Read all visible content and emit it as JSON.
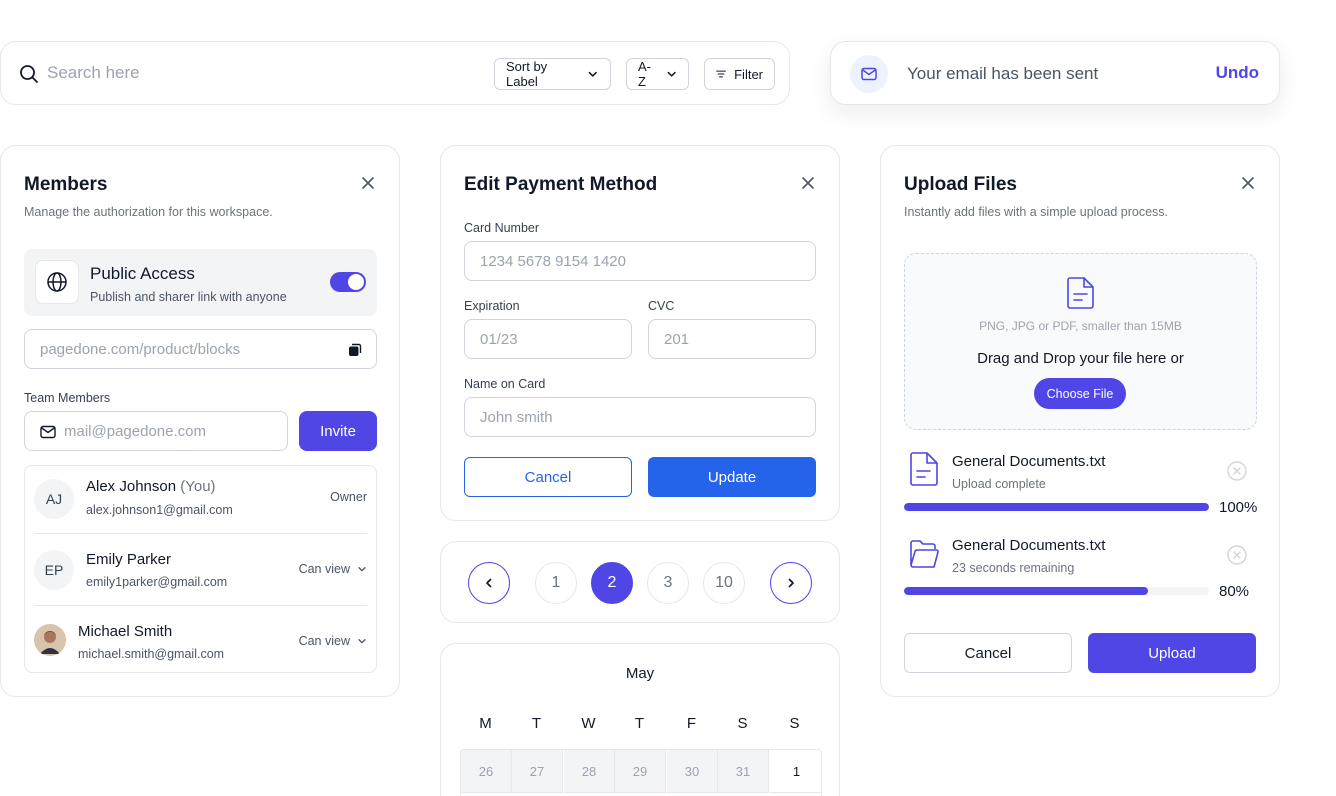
{
  "search": {
    "placeholder": "Search here",
    "sort_label": "Sort by Label",
    "order_label": "A-Z",
    "filter_label": "Filter"
  },
  "toast": {
    "message": "Your email has been sent",
    "action": "Undo"
  },
  "members": {
    "title": "Members",
    "subtitle": "Manage the authorization for this workspace.",
    "public_access": {
      "title": "Public Access",
      "subtitle": "Publish and sharer link with anyone",
      "enabled": true
    },
    "share_link": "pagedone.com/product/blocks",
    "team_label": "Team Members",
    "invite_placeholder": "mail@pagedone.com",
    "invite_button": "Invite",
    "list": [
      {
        "initials": "AJ",
        "name": "Alex Johnson",
        "you": "(You)",
        "email": "alex.johnson1@gmail.com",
        "role": "Owner"
      },
      {
        "initials": "EP",
        "name": "Emily Parker",
        "you": "",
        "email": "emily1parker@gmail.com",
        "role": "Can view"
      },
      {
        "initials": "",
        "name": "Michael Smith",
        "you": "",
        "email": "michael.smith@gmail.com",
        "role": "Can view"
      }
    ]
  },
  "payment": {
    "title": "Edit Payment Method",
    "card_label": "Card Number",
    "card_value": "1234 5678 9154 1420",
    "exp_label": "Expiration",
    "exp_value": "01/23",
    "cvc_label": "CVC",
    "cvc_value": "201",
    "name_label": "Name on Card",
    "name_value": "John smith",
    "cancel": "Cancel",
    "update": "Update"
  },
  "pagination": {
    "pages": [
      "1",
      "2",
      "3",
      "10"
    ],
    "current": "2"
  },
  "calendar": {
    "month": "May",
    "weekdays": [
      "M",
      "T",
      "W",
      "T",
      "F",
      "S",
      "S"
    ],
    "first_row": [
      "26",
      "27",
      "28",
      "29",
      "30",
      "31",
      "1"
    ]
  },
  "upload": {
    "title": "Upload Files",
    "subtitle": "Instantly add files with a simple upload process.",
    "hint": "PNG, JPG or PDF, smaller than 15MB",
    "drop_text": "Drag and Drop your file here or",
    "choose_button": "Choose File",
    "files": [
      {
        "name": "General Documents.txt",
        "status": "Upload complete",
        "progress_percent": 100,
        "label": "100%"
      },
      {
        "name": "General Documents.txt",
        "status": "23 seconds remaining",
        "progress_percent": 80,
        "label": "80%"
      }
    ],
    "cancel": "Cancel",
    "submit": "Upload"
  },
  "colors": {
    "accent": "#4f46e5",
    "primary_blue": "#2563eb",
    "border": "#e5e7eb"
  }
}
